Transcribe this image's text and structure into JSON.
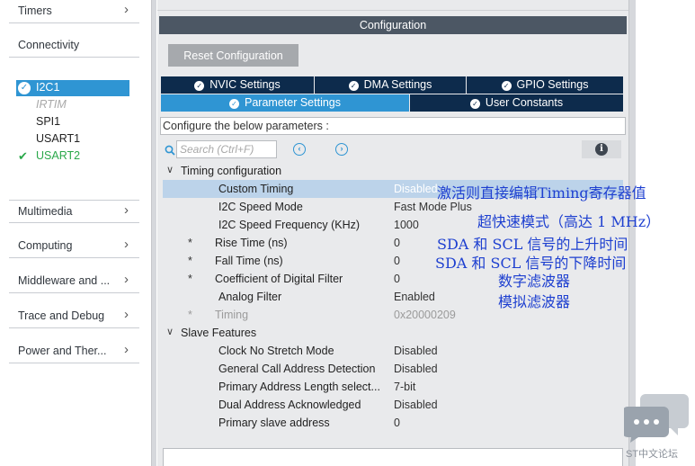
{
  "sidebar": {
    "categories": [
      {
        "label": "Timers"
      },
      {
        "label": "Connectivity"
      },
      {
        "label": "Multimedia"
      },
      {
        "label": "Computing"
      },
      {
        "label": "Middleware and ..."
      },
      {
        "label": "Trace and Debug"
      },
      {
        "label": "Power and Ther..."
      }
    ],
    "peripherals": [
      {
        "label": "I2C1",
        "state": "selected"
      },
      {
        "label": "IRTIM",
        "state": "disabled"
      },
      {
        "label": "SPI1",
        "state": "normal"
      },
      {
        "label": "USART1",
        "state": "normal"
      },
      {
        "label": "USART2",
        "state": "enabled"
      }
    ]
  },
  "config": {
    "title": "Configuration",
    "reset_label": "Reset Configuration",
    "tabs": [
      {
        "label": "NVIC Settings"
      },
      {
        "label": "DMA Settings"
      },
      {
        "label": "GPIO Settings"
      },
      {
        "label": "Parameter Settings",
        "active": true
      },
      {
        "label": "User Constants"
      }
    ],
    "configure_below": "Configure the below parameters :",
    "search_placeholder": "Search (Ctrl+F)",
    "info_glyph": "i"
  },
  "groups": [
    {
      "label": "Timing configuration",
      "params": [
        {
          "star": "",
          "name": "Custom Timing",
          "value": "Disabled",
          "selected": true
        },
        {
          "star": "",
          "name": "I2C Speed Mode",
          "value": "Fast Mode Plus"
        },
        {
          "star": "",
          "name": "I2C Speed Frequency (KHz)",
          "value": "1000"
        },
        {
          "star": "*",
          "name": "Rise Time (ns)",
          "value": "0"
        },
        {
          "star": "*",
          "name": "Fall Time (ns)",
          "value": "0"
        },
        {
          "star": "*",
          "name": "Coefficient of Digital Filter",
          "value": "0"
        },
        {
          "star": "",
          "name": "Analog Filter",
          "value": "Enabled"
        },
        {
          "star": "*",
          "name": "Timing",
          "value": "0x20000209",
          "gray": true
        }
      ]
    },
    {
      "label": "Slave Features",
      "params": [
        {
          "star": "",
          "name": "Clock No Stretch Mode",
          "value": "Disabled"
        },
        {
          "star": "",
          "name": "General Call Address Detection",
          "value": "Disabled"
        },
        {
          "star": "",
          "name": "Primary Address Length select...",
          "value": "7-bit"
        },
        {
          "star": "",
          "name": "Dual Address Acknowledged",
          "value": "Disabled"
        },
        {
          "star": "",
          "name": "Primary slave address",
          "value": "0"
        }
      ]
    }
  ],
  "annotations": [
    "激活则直接编辑Timing寄存器值",
    "超快速模式（高达 1 MHz）",
    "SDA 和 SCL 信号的上升时间",
    "SDA 和 SCL 信号的下降时间",
    "数字滤波器",
    "模拟滤波器"
  ],
  "watermark": {
    "text": "ST中文论坛"
  },
  "icons": {
    "chevron": "chevron-right-icon",
    "check": "check-icon",
    "search": "search-icon",
    "prev": "prev-icon",
    "next": "next-icon",
    "info": "info-icon"
  },
  "colors": {
    "title_bar": "#4c5764",
    "tab_dark": "#0d2b4c",
    "tab_active": "#2f95d3",
    "selection": "#bcd3ea",
    "annotation": "#1d3fd0",
    "enabled_green": "#2aa84a"
  }
}
